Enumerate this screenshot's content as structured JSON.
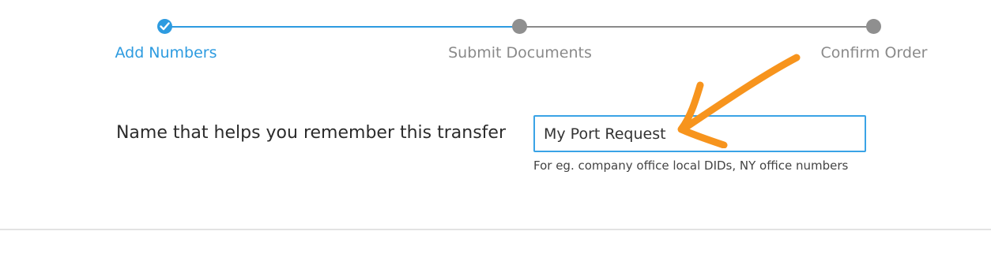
{
  "stepper": {
    "steps": [
      {
        "label": "Add Numbers",
        "state": "completed"
      },
      {
        "label": "Submit Documents",
        "state": "pending"
      },
      {
        "label": "Confirm Order",
        "state": "pending"
      }
    ],
    "active_color": "#2d9be0",
    "inactive_color": "#8f8f8f"
  },
  "form": {
    "name_label": "Name that helps you remember this transfer",
    "name_value": "My Port Request",
    "name_help": "For eg. company office local DIDs, NY office numbers",
    "input_border_color": "#3aa3e6"
  },
  "annotation": {
    "arrow_icon": "orange-arrow-icon",
    "arrow_color": "#f7941d"
  }
}
